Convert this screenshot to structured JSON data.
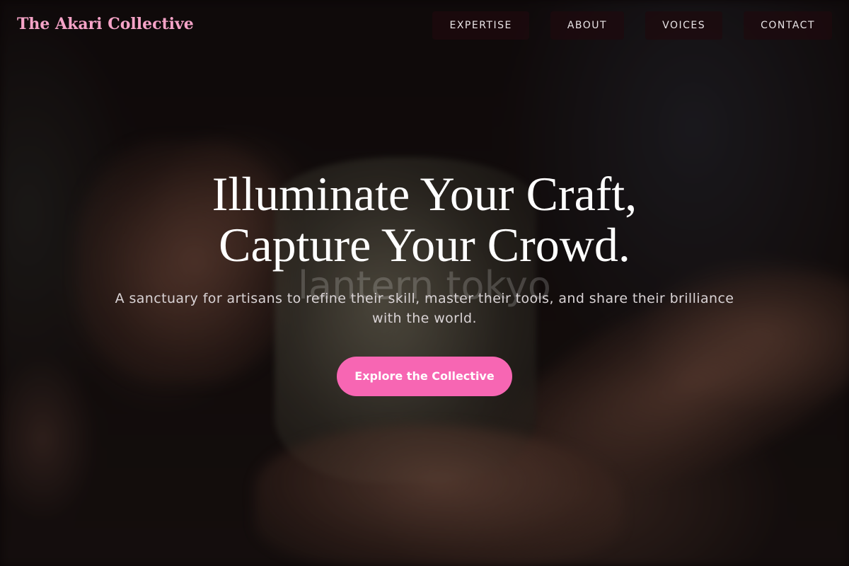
{
  "header": {
    "brand": "The Akari Collective",
    "nav": [
      {
        "label": "EXPERTISE"
      },
      {
        "label": "ABOUT"
      },
      {
        "label": "VOICES"
      },
      {
        "label": "CONTACT"
      }
    ]
  },
  "hero": {
    "headline_line1": "Illuminate Your Craft,",
    "headline_line2": "Capture Your Crowd.",
    "watermark": "lantern tokyo",
    "subtitle": "A sanctuary for artisans to refine their skill, master their tools, and share their brilliance with the world.",
    "cta_label": "Explore the Collective",
    "background_image": "hands-holding-ceramic-mug-photo"
  },
  "colors": {
    "brand": "#f5a3c7",
    "accent": "#f766b3",
    "nav_bg": "#1e0a0e",
    "text": "#ffffff"
  }
}
